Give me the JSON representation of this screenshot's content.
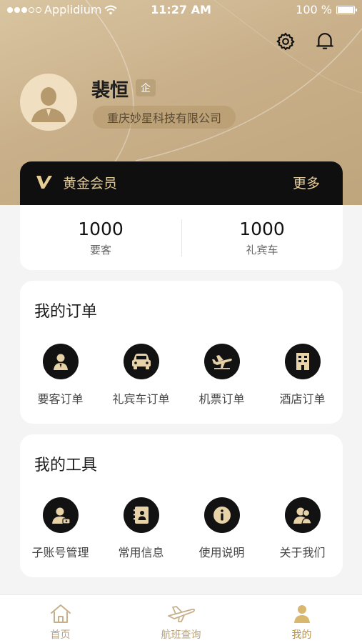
{
  "status_bar": {
    "carrier": "Applidium",
    "time": "11:27 AM",
    "battery": "100 %"
  },
  "header": {
    "settings_icon": "gear-icon",
    "notifications_icon": "bell-icon"
  },
  "profile": {
    "name": "裴恒",
    "badge": "企",
    "company": "重庆妙星科技有限公司",
    "avatar_icon": "user-avatar-icon"
  },
  "membership": {
    "logo_icon": "v-logo-icon",
    "title": "黄金会员",
    "more": "更多",
    "stats": [
      {
        "value": "1000",
        "label": "要客"
      },
      {
        "value": "1000",
        "label": "礼宾车"
      }
    ]
  },
  "orders": {
    "title": "我的订单",
    "items": [
      {
        "label": "要客订单",
        "icon": "vip-person-icon"
      },
      {
        "label": "礼宾车订单",
        "icon": "car-icon"
      },
      {
        "label": "机票订单",
        "icon": "plane-icon"
      },
      {
        "label": "酒店订单",
        "icon": "hotel-building-icon"
      }
    ]
  },
  "tools": {
    "title": "我的工具",
    "items": [
      {
        "label": "子账号管理",
        "icon": "sub-account-icon"
      },
      {
        "label": "常用信息",
        "icon": "contact-book-icon"
      },
      {
        "label": "使用说明",
        "icon": "info-icon"
      },
      {
        "label": "关于我们",
        "icon": "about-users-icon"
      }
    ]
  },
  "tabbar": {
    "active": "我的",
    "tabs": [
      {
        "label": "首页",
        "icon": "home-icon"
      },
      {
        "label": "航班查询",
        "icon": "flight-search-icon"
      },
      {
        "label": "我的",
        "icon": "profile-icon"
      }
    ]
  },
  "colors": {
    "gold": "#b9a179",
    "gold_text": "#e6cc95",
    "dark": "#121212",
    "hero_bg": "#cdb58f"
  }
}
